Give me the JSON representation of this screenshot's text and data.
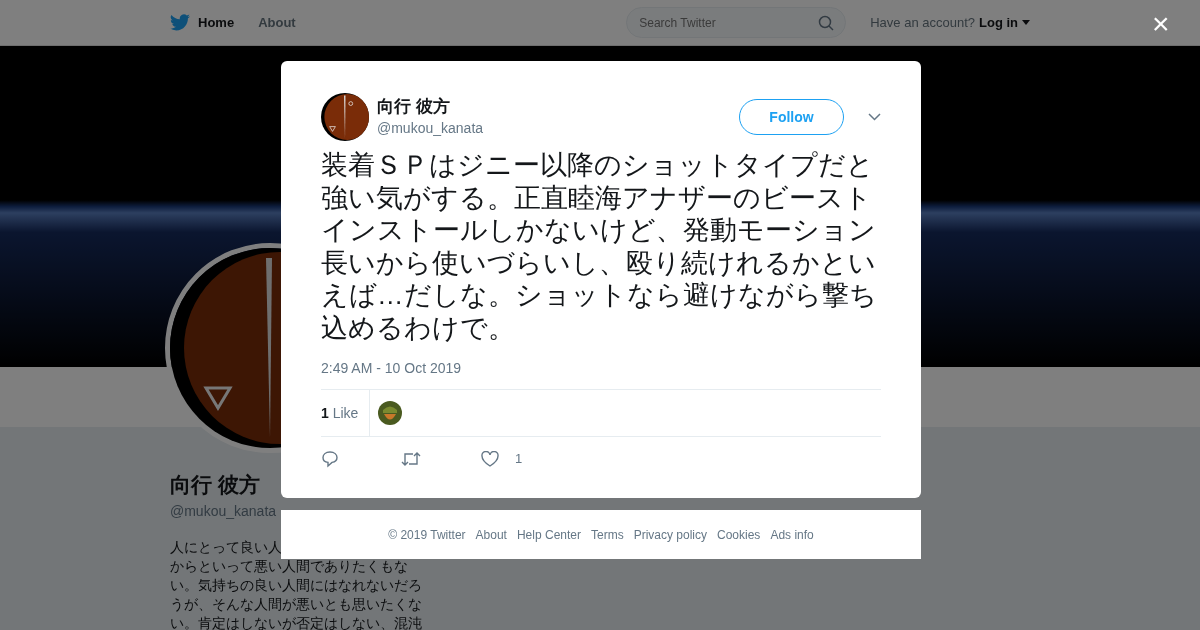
{
  "navbar": {
    "items": [
      {
        "label": "Home",
        "selected": true
      },
      {
        "label": "About",
        "selected": false
      }
    ],
    "search": {
      "placeholder": "Search Twitter"
    },
    "account_prompt": "Have an account?",
    "login": "Log in"
  },
  "profile": {
    "name": "向行 彼方",
    "handle": "@mukou_kanata",
    "bio_lines": [
      "人にとって良い人",
      "からといって悪い人間でありたくもな",
      "い。気持ちの良い人間にはなれないだろ",
      "うが、そんな人間が悪いとも思いたくな",
      "い。肯定はしないが否定はしない、混沌"
    ]
  },
  "tweet": {
    "name": "向行 彼方",
    "handle": "@mukou_kanata",
    "follow": "Follow",
    "text": "装着ＳＰはジニー以降のショットタイプだと強い気がする。正直睦海アナザーのビーストインストールしかないけど、発動モーション長いから使いづらいし、殴り続けれるかといえば…だしな。ショットなら避けながら撃ち込めるわけで。",
    "time": "2:49 AM - 10 Oct 2019",
    "like_count": "1",
    "like_label": "Like",
    "actions": [
      {
        "kind": "reply"
      },
      {
        "kind": "retweet"
      },
      {
        "kind": "like",
        "count": "1"
      }
    ]
  },
  "close": "×",
  "footer": [
    "© 2019 Twitter",
    "About",
    "Help Center",
    "Terms",
    "Privacy policy",
    "Cookies",
    "Ads info"
  ]
}
